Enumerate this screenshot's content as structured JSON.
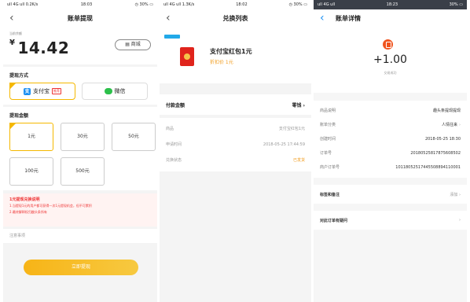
{
  "status": {
    "p1": {
      "left": "ull 4G ull 0.2K/s",
      "time": "18:03",
      "right": "◷ 30% ▭"
    },
    "p2": {
      "left": "ull 4G ull 1.3K/s",
      "time": "18:02",
      "right": "◷ 30% ▭"
    },
    "p3": {
      "left": "ull 4G ull",
      "time": "18:23",
      "right": "30% ▭"
    }
  },
  "p1": {
    "title": "账单提现",
    "balance_label": "当前余额",
    "currency": "¥",
    "balance": "14.42",
    "mall": "商城",
    "method_title": "提现方式",
    "methods": [
      {
        "label": "支付宝",
        "badge": "推荐"
      },
      {
        "label": "微信"
      }
    ],
    "amount_title": "提现金额",
    "amounts": [
      "1元",
      "30元",
      "50元",
      "100元",
      "500元"
    ],
    "notice_title": "1元提现兑换说明",
    "notice_lines": [
      "1.当提现1元的用户都可获得一次1元提现机会，但不可累积",
      "2.最终解释权归趣头条所有"
    ],
    "note": "注意事项",
    "submit": "立即提现"
  },
  "p2": {
    "title": "兑换列表",
    "product_name": "支付宝红包1元",
    "product_price": "折扣价 1元",
    "pay_label": "付款金额",
    "pay_value": "零钱 ›",
    "rows": [
      {
        "k": "商品",
        "v": "支付宝红包1元"
      },
      {
        "k": "申请时间",
        "v": "2018-05-25 17:44:59"
      },
      {
        "k": "兑换状态",
        "v": "已发货"
      }
    ]
  },
  "p3": {
    "title": "账单详情",
    "amount": "+1.00",
    "status": "交易成功",
    "rows": [
      {
        "k": "商品说明",
        "v": "趣头条提现提现"
      },
      {
        "k": "账单分类",
        "v": "人情往来"
      },
      {
        "k": "创建时间",
        "v": "2018-05-25 18:30"
      },
      {
        "k": "订单号",
        "v": "20180525817875608502"
      },
      {
        "k": "商户订单号",
        "v": "10118052517445508894110001"
      }
    ],
    "tags_label": "标签和备注",
    "tags_value": "添加",
    "question": "对此订单有疑问"
  }
}
